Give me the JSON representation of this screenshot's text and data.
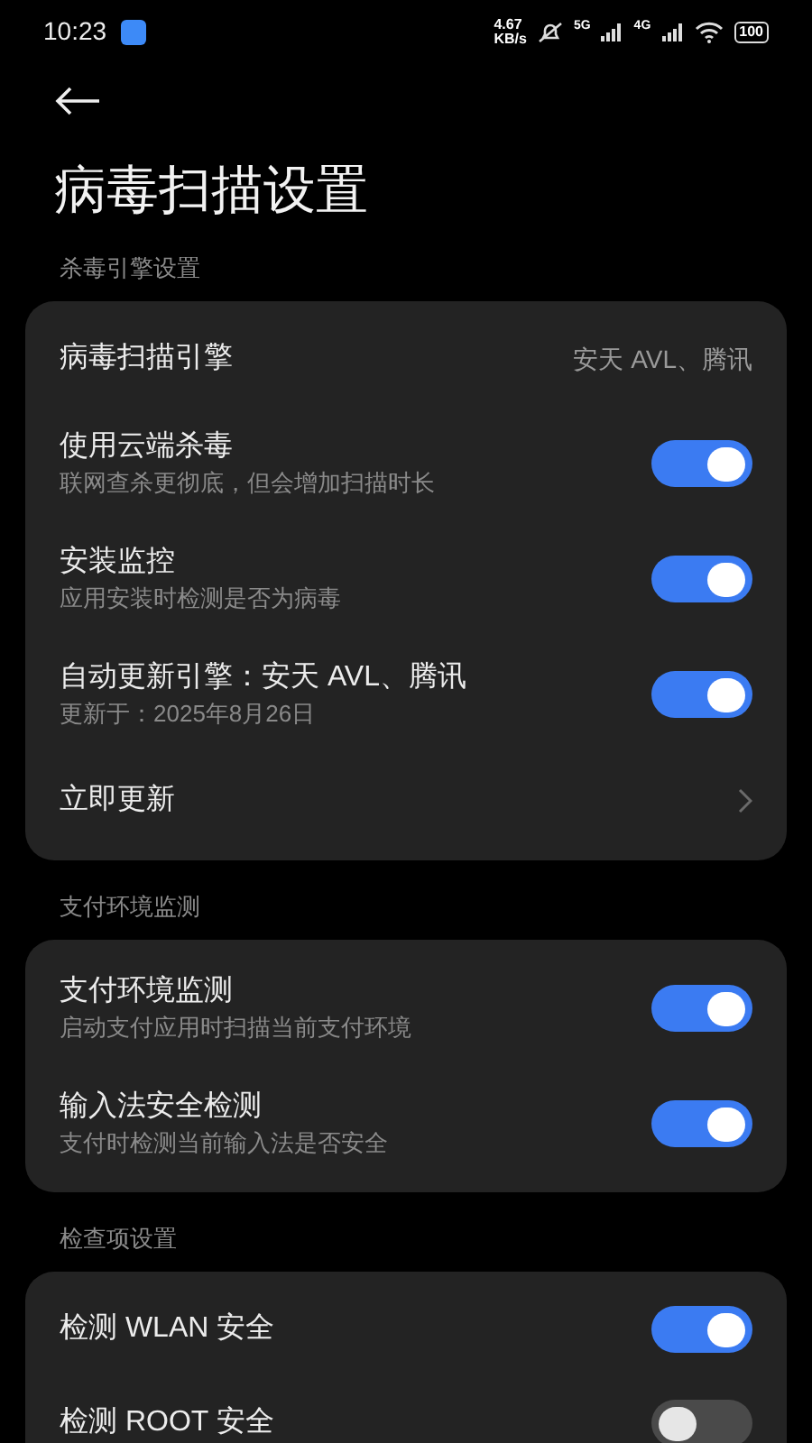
{
  "status_bar": {
    "time": "10:23",
    "net_speed_value": "4.67",
    "net_speed_unit": "KB/s",
    "sim1": "5G",
    "sim2": "4G",
    "battery": "100"
  },
  "title": "病毒扫描设置",
  "sections": [
    {
      "header": "杀毒引擎设置",
      "items": [
        {
          "kind": "value",
          "label": "病毒扫描引擎",
          "value": "安天 AVL、腾讯"
        },
        {
          "kind": "toggle",
          "label": "使用云端杀毒",
          "subtitle": "联网查杀更彻底，但会增加扫描时长",
          "on": true
        },
        {
          "kind": "toggle",
          "label": "安装监控",
          "subtitle": "应用安装时检测是否为病毒",
          "on": true
        },
        {
          "kind": "toggle",
          "label": "自动更新引擎：安天 AVL、腾讯",
          "subtitle": "更新于：2025年8月26日",
          "on": true
        },
        {
          "kind": "link",
          "label": "立即更新"
        }
      ]
    },
    {
      "header": "支付环境监测",
      "items": [
        {
          "kind": "toggle",
          "label": "支付环境监测",
          "subtitle": "启动支付应用时扫描当前支付环境",
          "on": true
        },
        {
          "kind": "toggle",
          "label": "输入法安全检测",
          "subtitle": "支付时检测当前输入法是否安全",
          "on": true
        }
      ]
    },
    {
      "header": "检查项设置",
      "items": [
        {
          "kind": "toggle",
          "label": "检测 WLAN 安全",
          "on": true
        },
        {
          "kind": "toggle",
          "label": "检测 ROOT 安全",
          "on": false
        }
      ]
    }
  ]
}
